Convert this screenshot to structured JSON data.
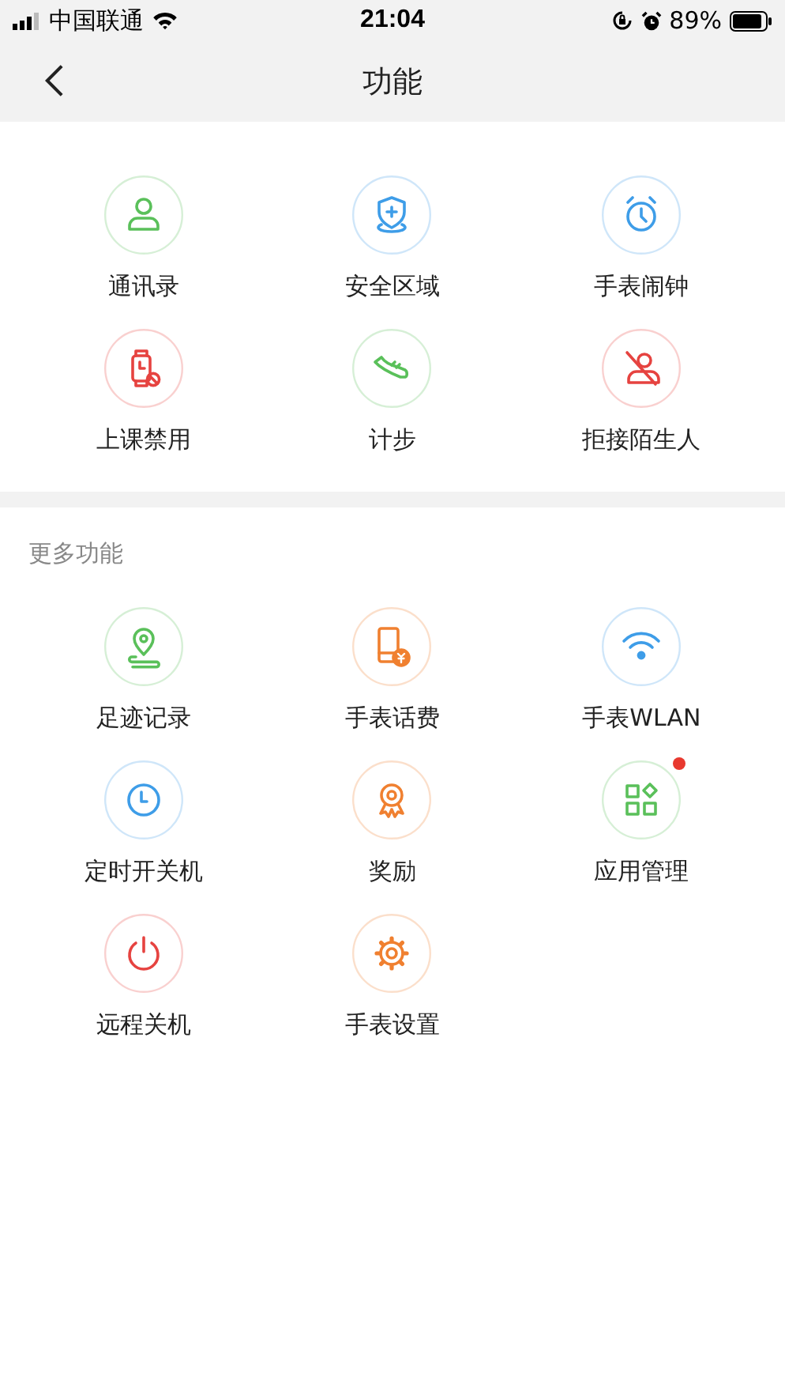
{
  "status_bar": {
    "carrier": "中国联通",
    "time": "21:04",
    "battery": "89%"
  },
  "nav": {
    "title": "功能"
  },
  "sections": [
    {
      "items": [
        {
          "label": "通讯录",
          "kind": "person",
          "color": "#5ac05a",
          "badge": false
        },
        {
          "label": "安全区域",
          "kind": "shield",
          "color": "#3e9de8",
          "badge": false
        },
        {
          "label": "手表闹钟",
          "kind": "alarm",
          "color": "#3e9de8",
          "badge": false
        },
        {
          "label": "上课禁用",
          "kind": "watch-ban",
          "color": "#e64340",
          "badge": false
        },
        {
          "label": "计步",
          "kind": "shoe",
          "color": "#5ac05a",
          "badge": false
        },
        {
          "label": "拒接陌生人",
          "kind": "person-ban",
          "color": "#e64340",
          "badge": false
        }
      ]
    },
    {
      "heading": "更多功能",
      "items": [
        {
          "label": "足迹记录",
          "kind": "location",
          "color": "#5ac05a",
          "badge": false
        },
        {
          "label": "手表话费",
          "kind": "phone-yuan",
          "color": "#f08030",
          "badge": false
        },
        {
          "label": "手表WLAN",
          "kind": "wifi",
          "color": "#3e9de8",
          "badge": false
        },
        {
          "label": "定时开关机",
          "kind": "clock",
          "color": "#3e9de8",
          "badge": false
        },
        {
          "label": "奖励",
          "kind": "medal",
          "color": "#f08030",
          "badge": false
        },
        {
          "label": "应用管理",
          "kind": "apps",
          "color": "#5ac05a",
          "badge": true
        },
        {
          "label": "远程关机",
          "kind": "power",
          "color": "#e64340",
          "badge": false
        },
        {
          "label": "手表设置",
          "kind": "gear",
          "color": "#f08030",
          "badge": false
        }
      ]
    }
  ]
}
